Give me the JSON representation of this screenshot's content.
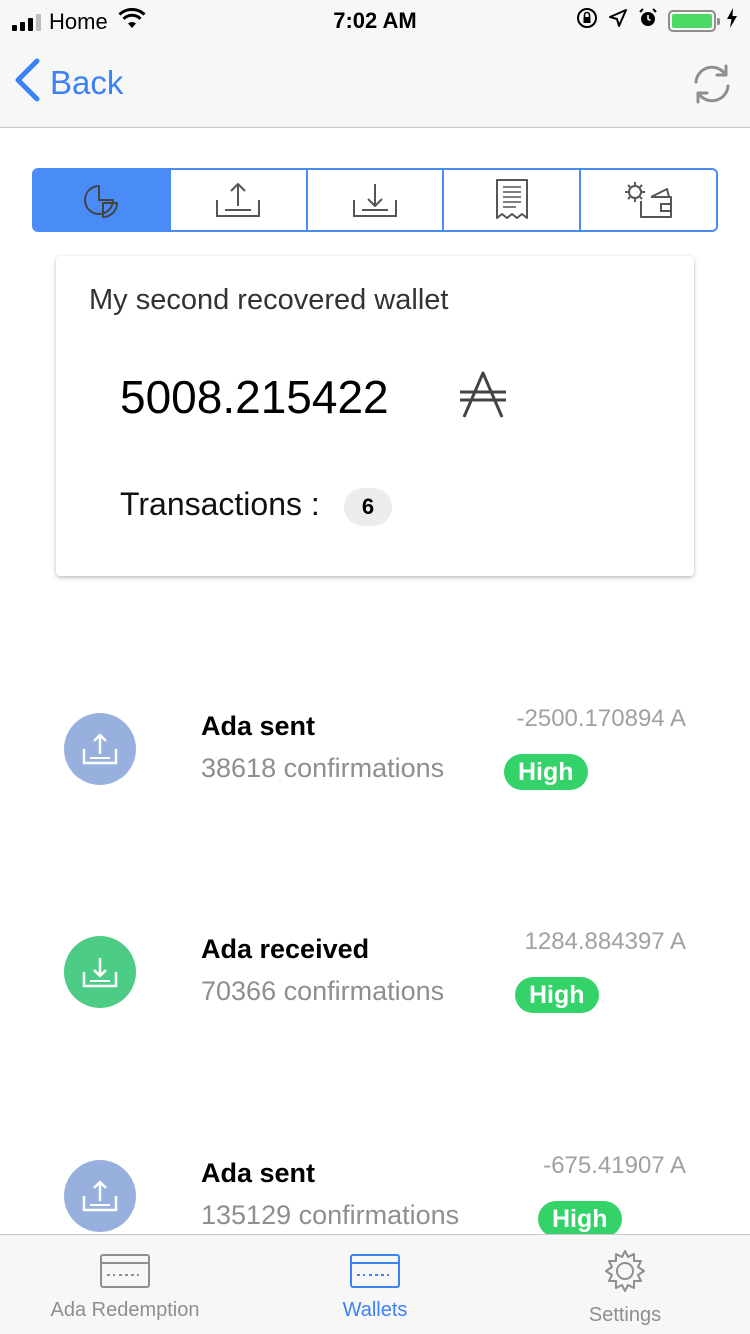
{
  "status_bar": {
    "carrier": "Home",
    "time": "7:02 AM",
    "icons": [
      "signal-icon",
      "wifi-icon",
      "orientation-lock-icon",
      "location-icon",
      "alarm-icon",
      "battery-icon"
    ]
  },
  "nav": {
    "back_label": "Back",
    "refresh_icon": "refresh-icon"
  },
  "segments": [
    {
      "icon": "pie-chart-icon",
      "active": true
    },
    {
      "icon": "upload-icon",
      "active": false
    },
    {
      "icon": "download-icon",
      "active": false
    },
    {
      "icon": "receipt-icon",
      "active": false
    },
    {
      "icon": "wallet-settings-icon",
      "active": false
    }
  ],
  "wallet": {
    "name": "My second recovered wallet",
    "balance": "5008.215422",
    "currency_symbol": "ada-icon",
    "transactions_label": "Transactions :",
    "transactions_count": "6"
  },
  "transactions": [
    {
      "type": "sent",
      "title": "Ada sent",
      "subtitle": "38618 confirmations",
      "amount": "-2500.170894 A",
      "level": "High"
    },
    {
      "type": "received",
      "title": "Ada received",
      "subtitle": "70366 confirmations",
      "amount": "1284.884397 A",
      "level": "High"
    },
    {
      "type": "sent",
      "title": "Ada sent",
      "subtitle": "135129 confirmations",
      "amount": "-675.41907 A",
      "level": "High"
    }
  ],
  "tabs": [
    {
      "label": "Ada Redemption",
      "icon": "card-icon",
      "active": false
    },
    {
      "label": "Wallets",
      "icon": "wallet-card-icon",
      "active": true
    },
    {
      "label": "Settings",
      "icon": "gear-icon",
      "active": false
    }
  ],
  "colors": {
    "accent": "#4a8cf7",
    "link": "#3b82f6",
    "sent_avatar": "#97b0de",
    "received_avatar": "#4ccc84",
    "level_badge": "#34d36a"
  }
}
